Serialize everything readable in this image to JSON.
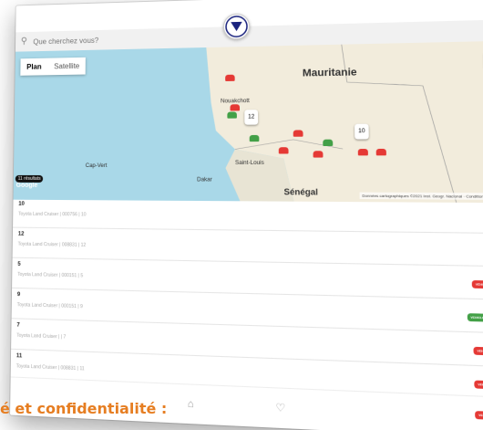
{
  "search": {
    "placeholder": "Que cherchez vous?"
  },
  "map": {
    "tab_plan": "Plan",
    "tab_satellite": "Satellite",
    "countries": [
      "Mauritanie",
      "Sénégal"
    ],
    "cities": [
      "Nouakchott",
      "Dakar",
      "Cap-Vert",
      "Saint-Louis"
    ],
    "clusters": [
      "12",
      "10"
    ],
    "google": "Google",
    "attribution": "Données cartographiques ©2021 Inst. Geogr. Nacional · Conditions d'utilisation"
  },
  "results": {
    "count_label": "11 résultats"
  },
  "vehicles": [
    {
      "id": "10",
      "detail": "Toyota Land Cruiser | 000756 | 10",
      "status": "",
      "color": ""
    },
    {
      "id": "12",
      "detail": "Toyota Land Cruiser | 008831 | 12",
      "status": "",
      "color": ""
    },
    {
      "id": "5",
      "detail": "Toyota Land Cruiser | 000151 | 5",
      "status": "VEHICLE IDLE",
      "color": "#e53935"
    },
    {
      "id": "9",
      "detail": "Toyota Land Cruiser | 000151 | 9",
      "status": "VEHICLE MOVING",
      "color": "#43a047"
    },
    {
      "id": "7",
      "detail": "Toyota Land Cruiser | | 7",
      "status": "VEHICLE IDLE",
      "color": "#e53935"
    },
    {
      "id": "11",
      "detail": "Toyota Land Cruiser | 008831 | 11",
      "status": "VEHICLE IDLE",
      "color": "#e53935"
    }
  ],
  "extra_badges": [
    "VEHICLE IDLE",
    "VEHICLE IDLE"
  ],
  "heading": "é et confidentialité :"
}
